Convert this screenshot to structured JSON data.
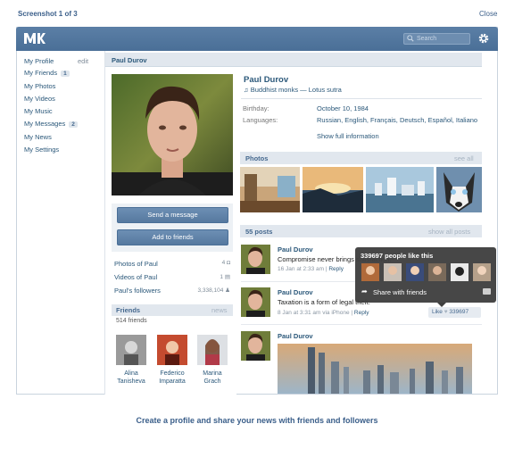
{
  "header": {
    "title": "Screenshot 1 of 3",
    "close_label": "Close"
  },
  "vk": {
    "search_placeholder": "Search"
  },
  "nav": {
    "edit_label": "edit",
    "items": [
      {
        "label": "My Profile"
      },
      {
        "label": "My Friends",
        "badge": "1"
      },
      {
        "label": "My Photos"
      },
      {
        "label": "My Videos"
      },
      {
        "label": "My Music"
      },
      {
        "label": "My Messages",
        "badge": "2"
      },
      {
        "label": "My News"
      },
      {
        "label": "My Settings"
      }
    ]
  },
  "profile": {
    "name_bar": "Paul Durov",
    "name": "Paul Durov",
    "status": "Buddhist monks — Lotus sutra",
    "birthday_label": "Birthday:",
    "birthday_value": "October 10, 1984",
    "languages_label": "Languages:",
    "languages_value": "Russian, English, Français, Deutsch, Español, Italiano",
    "show_full": "Show full information",
    "send_message": "Send a message",
    "add_friends": "Add to friends",
    "stats": [
      {
        "label": "Photos of Paul",
        "count": "4"
      },
      {
        "label": "Videos of Paul",
        "count": "1"
      },
      {
        "label": "Paul's followers",
        "count": "3,338,104"
      }
    ]
  },
  "friends": {
    "heading": "Friends",
    "news_label": "news",
    "count_text": "514 friends",
    "people": [
      {
        "first": "Alina",
        "last": "Tanisheva"
      },
      {
        "first": "Federico",
        "last": "Imparatta"
      },
      {
        "first": "Marina",
        "last": "Grach"
      }
    ]
  },
  "photos": {
    "heading": "Photos",
    "see_all": "see all"
  },
  "posts": {
    "heading": "55 posts",
    "show_all": "show all posts",
    "items": [
      {
        "author": "Paul Durov",
        "text": "Compromise never brings satisfaction.",
        "meta": "16 Jan at 2:33 am",
        "reply": "Reply"
      },
      {
        "author": "Paul Durov",
        "text": "Taxation is a form of legal theft.",
        "meta": "8 Jan at 3:31 am via iPhone",
        "reply": "Reply"
      },
      {
        "author": "Paul Durov"
      }
    ],
    "like_label": "Like",
    "like_count": "339697"
  },
  "popup": {
    "title": "339697 people like this",
    "share": "Share with friends"
  },
  "footer": {
    "tagline": "Create a profile and share your news with friends and followers"
  },
  "colors": {
    "brand_bar": "#4a6f97",
    "link": "#2b587a",
    "section_bg": "#e1e7ee"
  }
}
